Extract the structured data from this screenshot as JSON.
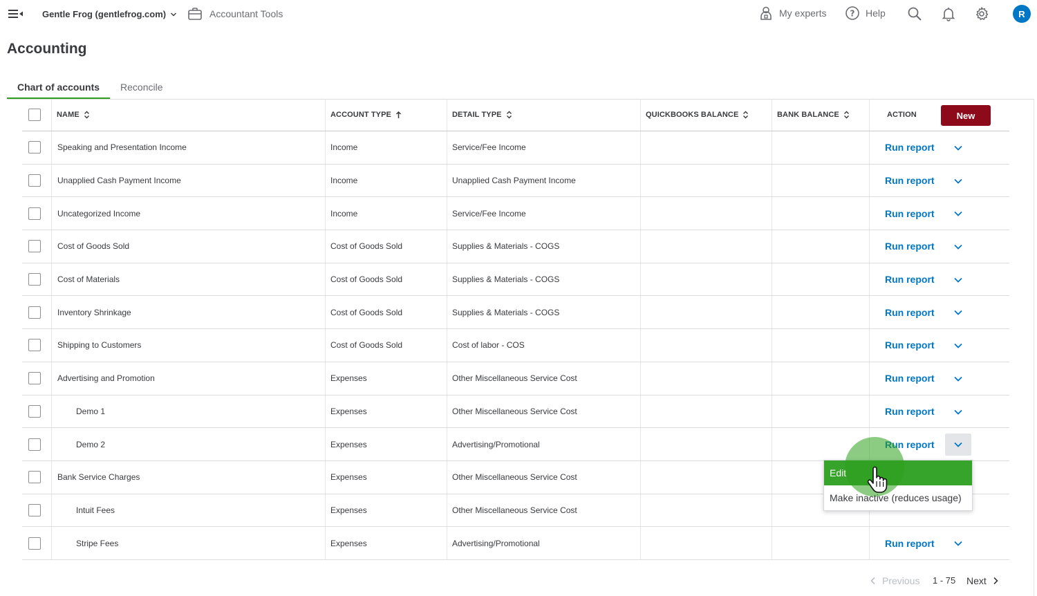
{
  "topbar": {
    "company": "Gentle Frog (gentlefrog.com)",
    "accountant_tools": "Accountant Tools",
    "my_experts": "My experts",
    "help": "Help",
    "avatar_letter": "R"
  },
  "page": {
    "title": "Accounting"
  },
  "tabs": [
    {
      "label": "Chart of accounts",
      "active": true
    },
    {
      "label": "Reconcile",
      "active": false
    }
  ],
  "table": {
    "columns": {
      "name": "NAME",
      "account_type": "ACCOUNT TYPE",
      "detail_type": "DETAIL TYPE",
      "qb_balance": "QUICKBOOKS BALANCE",
      "bank_balance": "BANK BALANCE",
      "action": "ACTION"
    },
    "new_button": "New",
    "action_label": "Run report",
    "rows": [
      {
        "name": "Speaking and Presentation Income",
        "type": "Income",
        "detail": "Service/Fee Income",
        "sub": false
      },
      {
        "name": "Unapplied Cash Payment Income",
        "type": "Income",
        "detail": "Unapplied Cash Payment Income",
        "sub": false
      },
      {
        "name": "Uncategorized Income",
        "type": "Income",
        "detail": "Service/Fee Income",
        "sub": false
      },
      {
        "name": "Cost of Goods Sold",
        "type": "Cost of Goods Sold",
        "detail": "Supplies & Materials - COGS",
        "sub": false
      },
      {
        "name": "Cost of Materials",
        "type": "Cost of Goods Sold",
        "detail": "Supplies & Materials - COGS",
        "sub": false
      },
      {
        "name": "Inventory Shrinkage",
        "type": "Cost of Goods Sold",
        "detail": "Supplies & Materials - COGS",
        "sub": false
      },
      {
        "name": "Shipping to Customers",
        "type": "Cost of Goods Sold",
        "detail": "Cost of labor - COS",
        "sub": false
      },
      {
        "name": "Advertising and Promotion",
        "type": "Expenses",
        "detail": "Other Miscellaneous Service Cost",
        "sub": false
      },
      {
        "name": "Demo 1",
        "type": "Expenses",
        "detail": "Other Miscellaneous Service Cost",
        "sub": true
      },
      {
        "name": "Demo 2",
        "type": "Expenses",
        "detail": "Advertising/Promotional",
        "sub": true,
        "menu_open": true
      },
      {
        "name": "Bank Service Charges",
        "type": "Expenses",
        "detail": "Other Miscellaneous Service Cost",
        "sub": false,
        "hidden_action": true
      },
      {
        "name": "Intuit Fees",
        "type": "Expenses",
        "detail": "Other Miscellaneous Service Cost",
        "sub": true,
        "hidden_action": true
      },
      {
        "name": "Stripe Fees",
        "type": "Expenses",
        "detail": "Advertising/Promotional",
        "sub": true
      }
    ]
  },
  "dropdown": {
    "items": [
      "Edit",
      "Make inactive (reduces usage)"
    ]
  },
  "pagination": {
    "previous": "Previous",
    "range": "1 - 75",
    "next": "Next"
  },
  "colors": {
    "accent_green": "#2ca01c",
    "link_blue": "#0077c5",
    "new_button": "#8d0a1a"
  }
}
